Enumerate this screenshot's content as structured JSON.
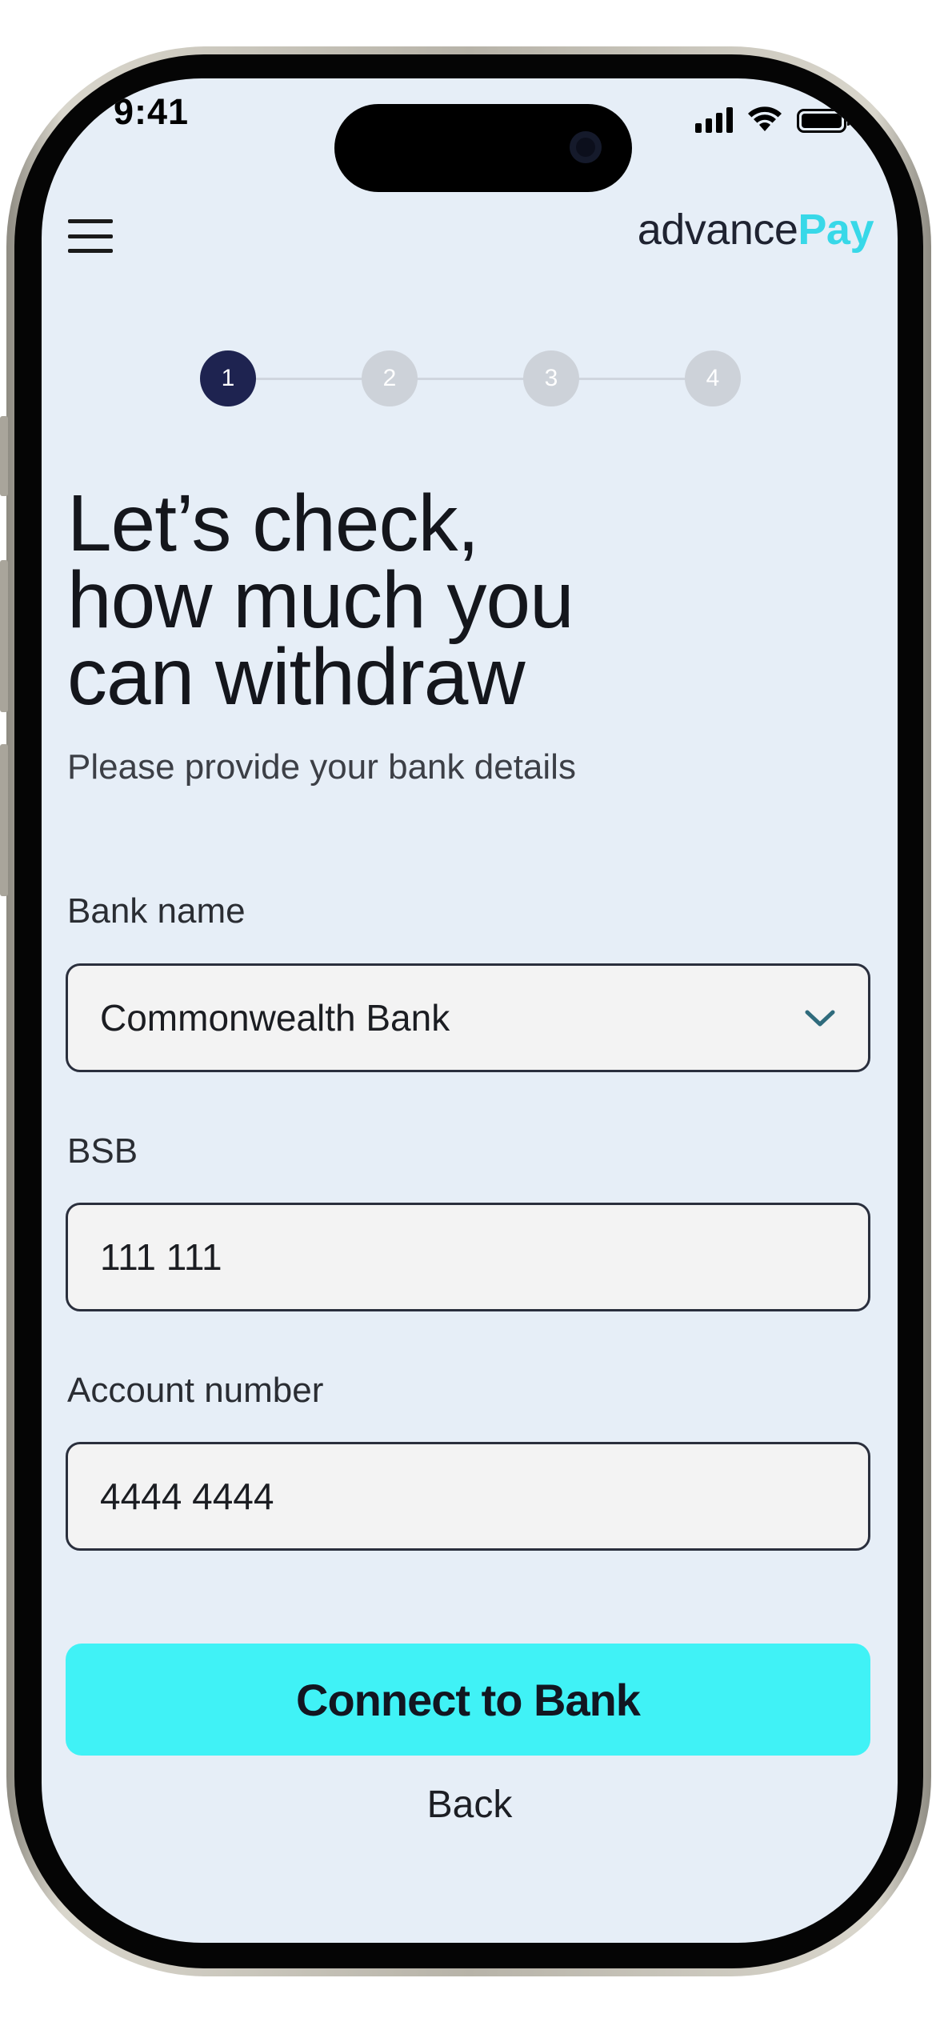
{
  "status_bar": {
    "time": "9:41"
  },
  "header": {
    "logo_primary": "advance",
    "logo_accent": "Pay",
    "menu_icon": "hamburger-menu-icon"
  },
  "stepper": {
    "steps": [
      "1",
      "2",
      "3",
      "4"
    ],
    "active_step": 1
  },
  "heading": {
    "lines": [
      "Let’s check,",
      "how much you",
      "can withdraw"
    ]
  },
  "subheading": "Please provide your bank details",
  "form": {
    "bank_name": {
      "label": "Bank name",
      "value": "Commonwealth Bank",
      "icon": "chevron-down-icon"
    },
    "bsb": {
      "label": "BSB",
      "value": "111 111"
    },
    "account_number": {
      "label": "Account number",
      "value": "4444 4444"
    }
  },
  "actions": {
    "connect_label": "Connect to Bank",
    "back_label": "Back"
  },
  "colors": {
    "screen_background": "#e6eef7",
    "accent": "#40f2f6",
    "logo_accent": "#38d8e8",
    "step_active": "#1e2350",
    "step_inactive": "#cdd2d9"
  }
}
